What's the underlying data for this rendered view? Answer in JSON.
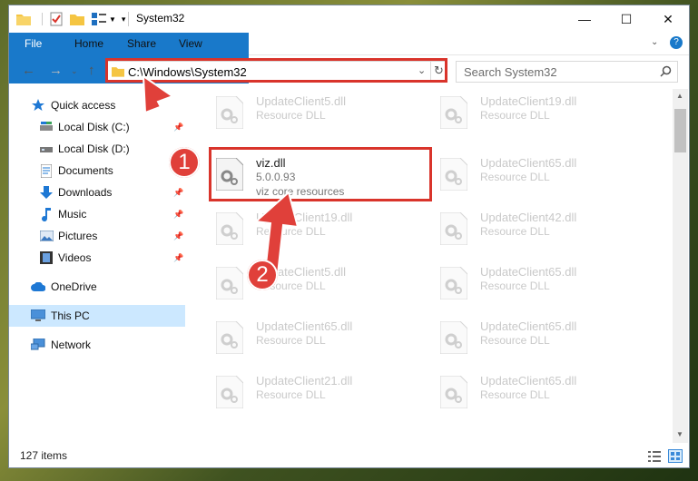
{
  "window": {
    "title": "System32"
  },
  "ribbon": {
    "tabs": [
      "File",
      "Home",
      "Share",
      "View"
    ]
  },
  "address": {
    "path": "C:\\Windows\\System32",
    "search_placeholder": "Search System32"
  },
  "sidebar": {
    "items": [
      {
        "label": "Quick access"
      },
      {
        "label": "Local Disk (C:)"
      },
      {
        "label": "Local Disk (D:)"
      },
      {
        "label": "Documents"
      },
      {
        "label": "Downloads"
      },
      {
        "label": "Music"
      },
      {
        "label": "Pictures"
      },
      {
        "label": "Videos"
      },
      {
        "label": "OneDrive"
      },
      {
        "label": "This PC"
      },
      {
        "label": "Network"
      }
    ]
  },
  "files": {
    "left": [
      {
        "name": "UpdateClient5.dll",
        "type": "Resource DLL"
      },
      {
        "name": "viz.dll",
        "version": "5.0.0.93",
        "description": "viz core resources"
      },
      {
        "name": "UpdateClient19.dll",
        "type": "Resource DLL"
      },
      {
        "name": "UpdateClient5.dll",
        "type": "Resource DLL"
      },
      {
        "name": "UpdateClient65.dll",
        "type": "Resource DLL"
      },
      {
        "name": "UpdateClient21.dll",
        "type": "Resource DLL"
      }
    ],
    "right": [
      {
        "name": "UpdateClient19.dll",
        "type": "Resource DLL"
      },
      {
        "name": "UpdateClient65.dll",
        "type": "Resource DLL"
      },
      {
        "name": "UpdateClient42.dll",
        "type": "Resource DLL"
      },
      {
        "name": "UpdateClient65.dll",
        "type": "Resource DLL"
      },
      {
        "name": "UpdateClient65.dll",
        "type": "Resource DLL"
      },
      {
        "name": "UpdateClient65.dll",
        "type": "Resource DLL"
      }
    ]
  },
  "status": {
    "item_count": "127 items"
  },
  "annotations": {
    "step1": "1",
    "step2": "2",
    "color": "#e0403a"
  }
}
